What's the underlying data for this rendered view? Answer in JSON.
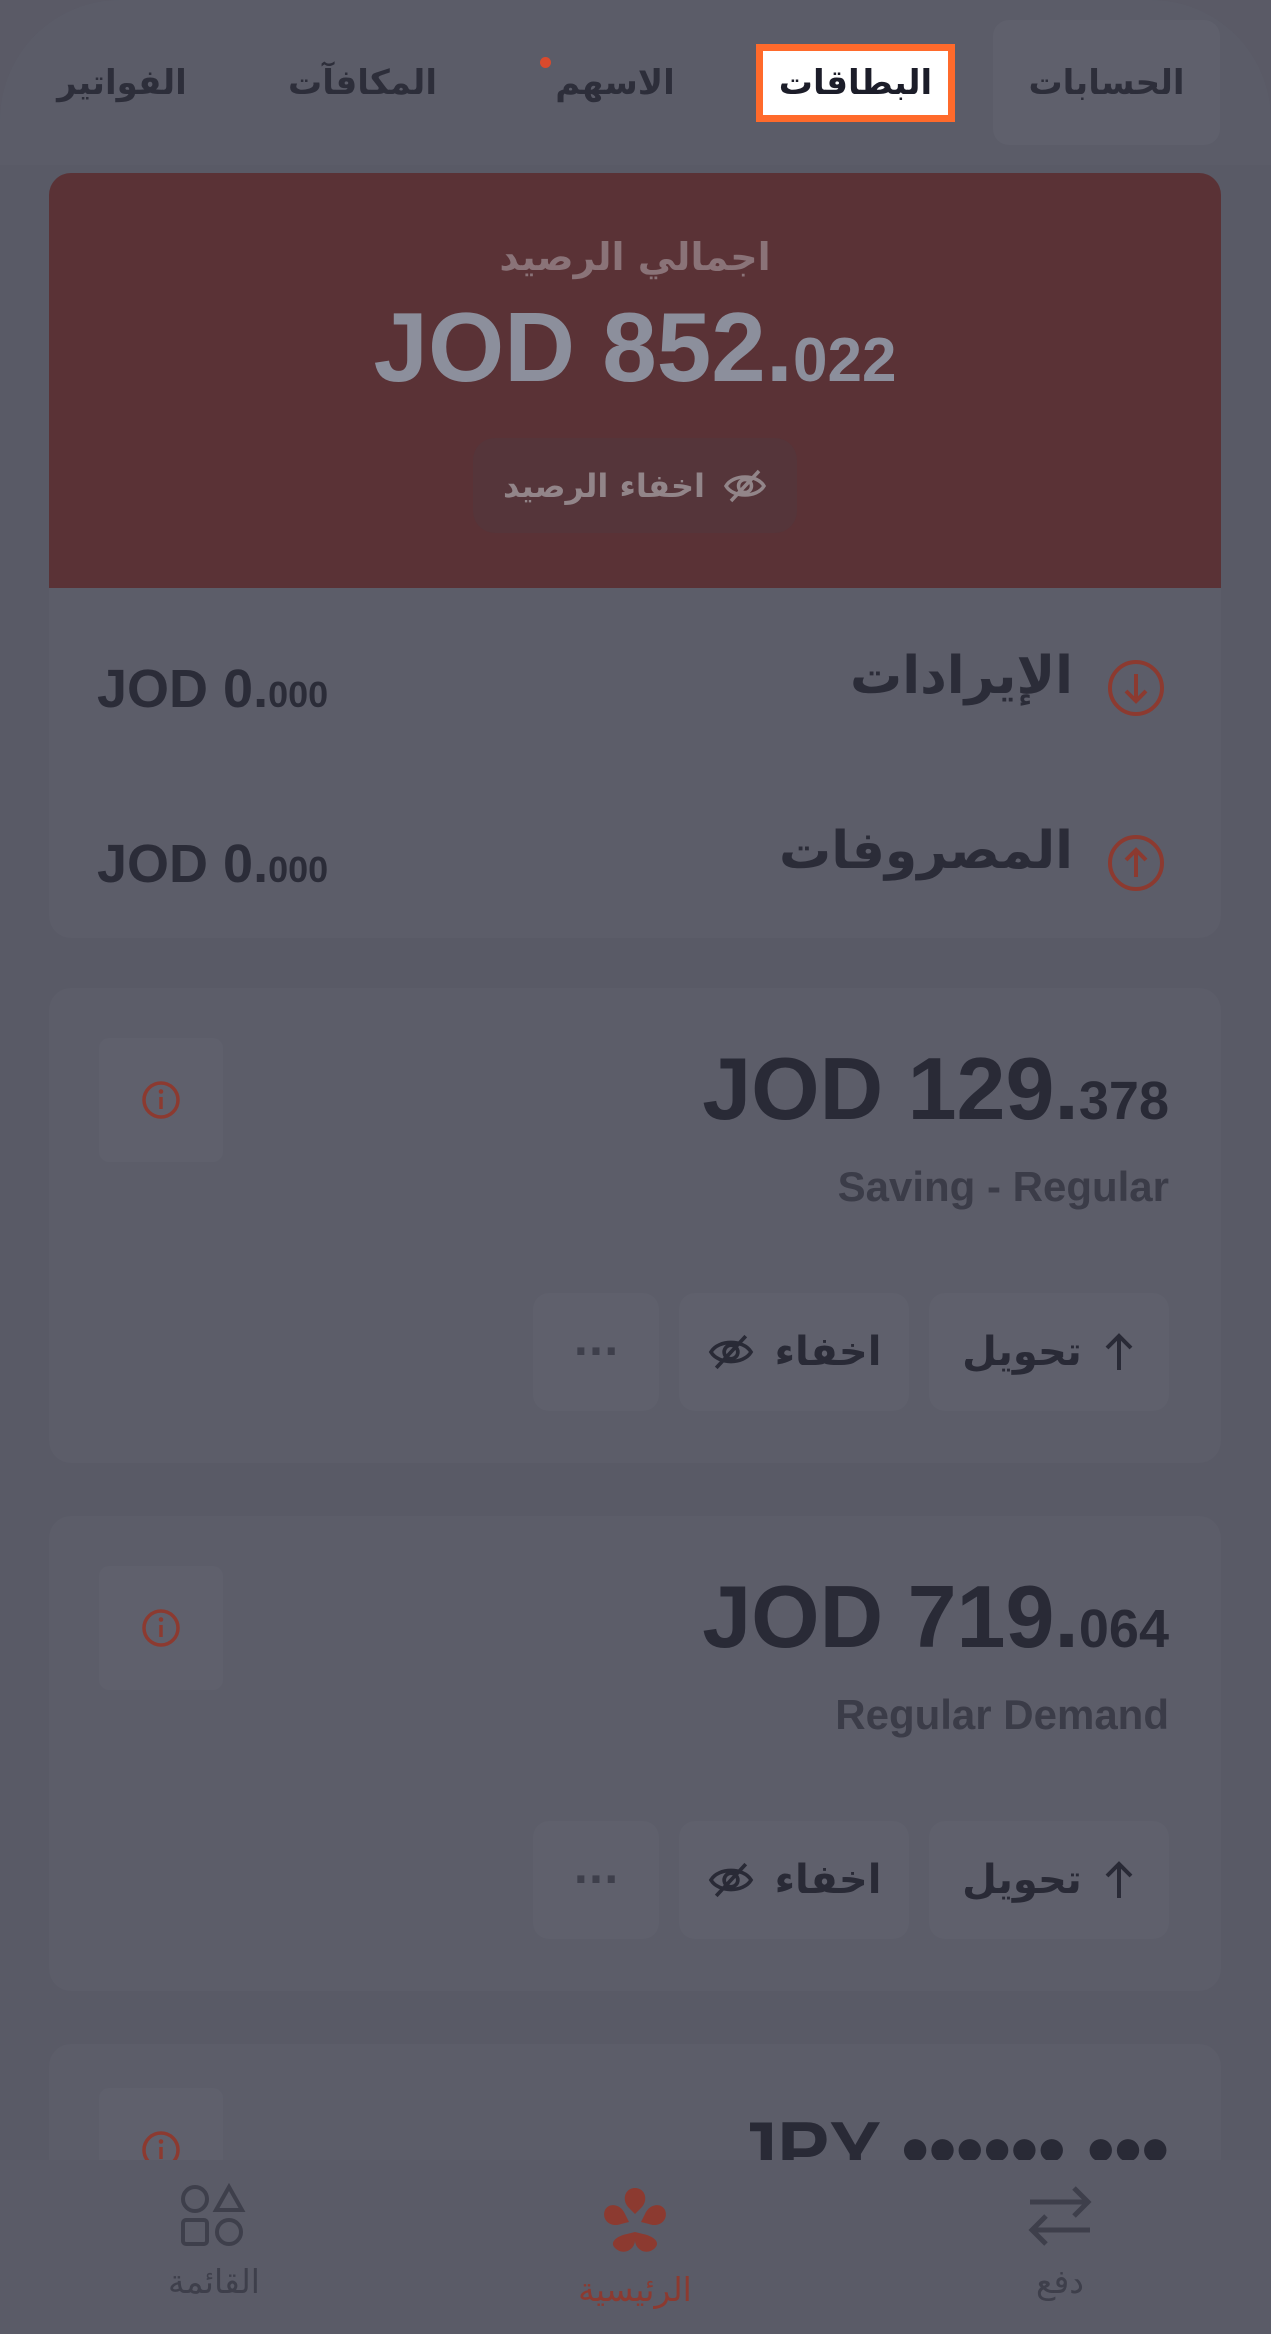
{
  "tabs": [
    {
      "label": "الحسابات"
    },
    {
      "label": "البطاقات"
    },
    {
      "label": "الاسهم"
    },
    {
      "label": "المكافآت"
    },
    {
      "label": "الفواتير"
    }
  ],
  "balance": {
    "title": "اجمالي الرصيد",
    "amount_main": "JOD 852.",
    "amount_decimal": "022",
    "hide_label": "اخفاء الرصيد"
  },
  "flows": {
    "income": {
      "label": "الإيرادات",
      "amount_main": "JOD 0.",
      "amount_decimal": "000"
    },
    "expense": {
      "label": "المصروفات",
      "amount_main": "JOD 0.",
      "amount_decimal": "000"
    }
  },
  "accounts": [
    {
      "amount_main": "JOD 129.",
      "amount_decimal": "378",
      "type": "Saving - Regular",
      "transfer_label": "تحويل",
      "hide_label": "اخفاء",
      "more_label": "···"
    },
    {
      "amount_main": "JOD 719.",
      "amount_decimal": "064",
      "type": "Regular Demand",
      "transfer_label": "تحويل",
      "hide_label": "اخفاء",
      "more_label": "···"
    },
    {
      "amount_main": "JPY ••••••.•••"
    }
  ],
  "bottom_nav": {
    "menu": "القائمة",
    "home": "الرئيسية",
    "pay": "دفع"
  },
  "colors": {
    "accent": "#ff6a2b",
    "brand_red": "#d94a2d",
    "overlay": "#5a5a66"
  }
}
